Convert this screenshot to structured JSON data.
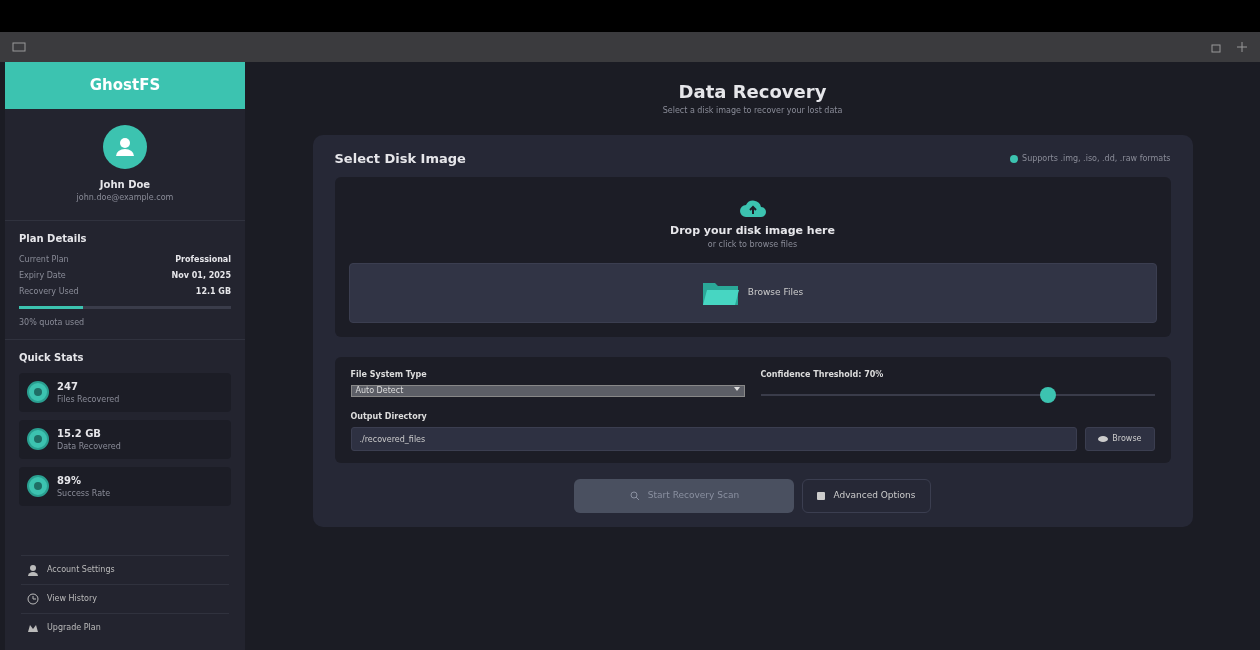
{
  "sidebar": {
    "brand": "GhostFS",
    "user": {
      "name": "John Doe",
      "email": "john.doe@example.com"
    },
    "plan": {
      "title": "Plan Details",
      "rows": [
        {
          "label": "Current Plan",
          "value": "Professional"
        },
        {
          "label": "Expiry Date",
          "value": "Nov 01, 2025"
        },
        {
          "label": "Recovery Used",
          "value": "12.1 GB"
        }
      ],
      "level": 0.3,
      "note": "30% quota used"
    },
    "stats_title": "Quick Stats",
    "stats": [
      {
        "value": "247",
        "label": "Files Recovered"
      },
      {
        "value": "15.2 GB",
        "label": "Data Recovered"
      },
      {
        "value": "89%",
        "label": "Success Rate"
      }
    ],
    "links": [
      {
        "kind": "settings",
        "label": "Account Settings"
      },
      {
        "kind": "history",
        "label": "View History"
      },
      {
        "kind": "upgrade",
        "label": "Upgrade Plan"
      }
    ]
  },
  "header": {
    "title": "Data Recovery",
    "subtitle": "Select a disk image to recover your lost data"
  },
  "card": {
    "title": "Select Disk Image",
    "formats": "Supports .img, .iso, .dd, .raw formats",
    "drop": {
      "title": "Drop your disk image here",
      "hint": "or click to browse files",
      "button": "Browse Files"
    },
    "fs_label": "File System Type",
    "fs_value": "Auto Detect",
    "threshold_label": "Confidence Threshold: 70%",
    "threshold": {
      "level": 0.73
    },
    "output_label": "Output Directory",
    "output_value": "./recovered_files",
    "output_button": "Browse",
    "start": {
      "label": "Start Recovery Scan",
      "disabled": true
    },
    "advanced": "Advanced Options"
  }
}
